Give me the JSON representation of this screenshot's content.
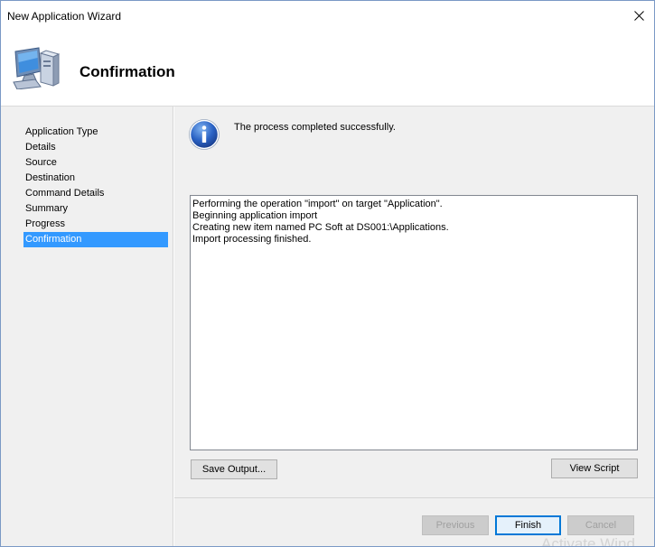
{
  "window": {
    "title": "New Application Wizard"
  },
  "header": {
    "title": "Confirmation",
    "icon": "computer-icon"
  },
  "nav": {
    "items": [
      {
        "label": "Application Type",
        "active": false
      },
      {
        "label": "Details",
        "active": false
      },
      {
        "label": "Source",
        "active": false
      },
      {
        "label": "Destination",
        "active": false
      },
      {
        "label": "Command Details",
        "active": false
      },
      {
        "label": "Summary",
        "active": false
      },
      {
        "label": "Progress",
        "active": false
      },
      {
        "label": "Confirmation",
        "active": true
      }
    ]
  },
  "main": {
    "status_icon": "info-icon",
    "status_text": "The process completed successfully.",
    "output_lines": [
      "Performing the operation \"import\" on target \"Application\".",
      "Beginning application import",
      "Creating new item named PC Soft at DS001:\\Applications.",
      "Import processing finished."
    ],
    "save_output_label": "Save Output...",
    "view_script_label": "View Script"
  },
  "footer": {
    "previous_label": "Previous",
    "finish_label": "Finish",
    "cancel_label": "Cancel"
  },
  "watermark": {
    "text": "Activate Wind"
  },
  "colors": {
    "accent": "#3399ff",
    "panel": "#f0f0f0",
    "focus_border": "#0078d7"
  }
}
